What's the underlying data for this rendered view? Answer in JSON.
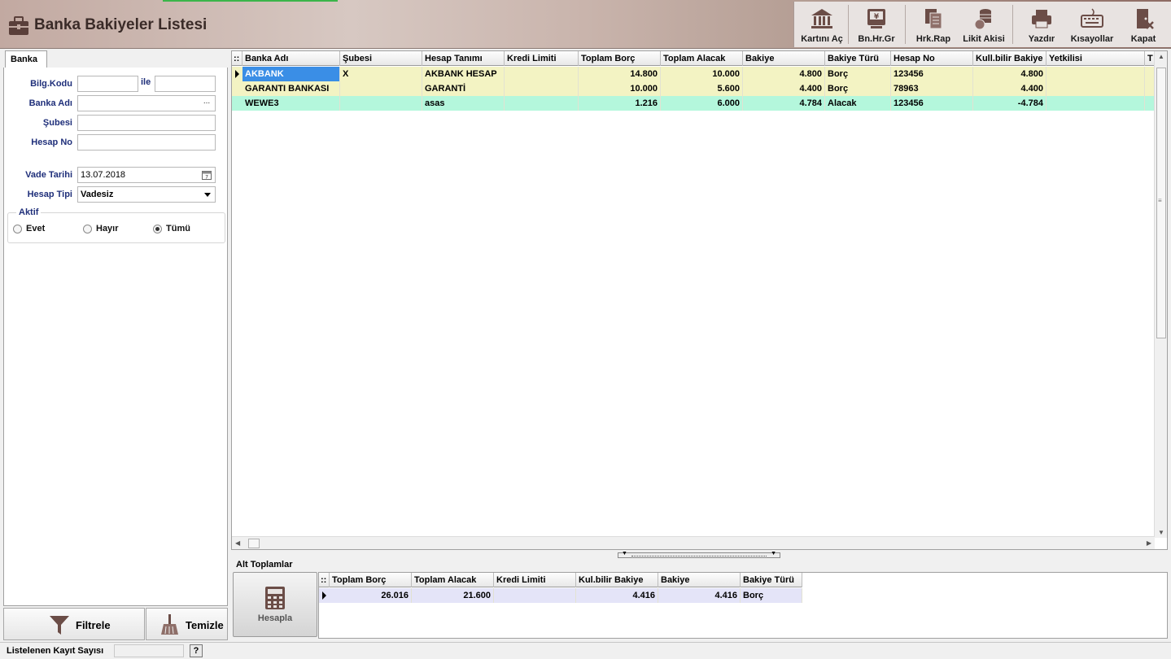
{
  "window": {
    "title": "Banka Bakiyeler Listesi"
  },
  "toolbar": [
    {
      "label": "Kartını Aç",
      "icon": "bank-icon"
    },
    {
      "label": "Bn.Hr.Gr",
      "icon": "atm-icon"
    },
    {
      "label": "Hrk.Rap",
      "icon": "report-icon"
    },
    {
      "label": "Likit Akisi",
      "icon": "coins-icon"
    },
    {
      "label": "Yazdır",
      "icon": "printer-icon"
    },
    {
      "label": "Kısayollar",
      "icon": "keyboard-icon"
    },
    {
      "label": "Kapat",
      "icon": "close-door-icon"
    }
  ],
  "filter": {
    "tab": "Banka",
    "bilg_kodu_label": "Bilg.Kodu",
    "ile_label": "ile",
    "banka_adi_label": "Banka Adı",
    "ellipsis": "...",
    "subesi_label": "Şubesi",
    "hesap_no_label": "Hesap No",
    "vade_tarihi_label": "Vade Tarihi",
    "vade_tarihi_value": "13.07.2018",
    "hesap_tipi_label": "Hesap Tipi",
    "hesap_tipi_value": "Vadesiz",
    "aktif_label": "Aktif",
    "aktif_options": [
      "Evet",
      "Hayır",
      "Tümü"
    ],
    "aktif_selected": "Tümü",
    "filtrele": "Filtrele",
    "temizle": "Temizle"
  },
  "grid": {
    "corner": "::",
    "columns": [
      "Banka Adı",
      "Şubesi",
      "Hesap Tanımı",
      "Kredi Limiti",
      "Toplam Borç",
      "Toplam Alacak",
      "Bakiye",
      "Bakiye Türü",
      "Hesap No",
      "Kull.bilir Bakiye",
      "Yetkilisi",
      "T"
    ],
    "rows": [
      {
        "banka_adi": "AKBANK",
        "subesi": "X",
        "hesap_tanimi": "AKBANK HESAP",
        "kredi_limiti": "",
        "toplam_borc": "14.800",
        "toplam_alacak": "10.000",
        "bakiye": "4.800",
        "bakiye_turu": "Borç",
        "hesap_no": "123456",
        "kull_bakiye": "4.800",
        "yetkilisi": "",
        "color": "#f3f3c3"
      },
      {
        "banka_adi": "GARANTI BANKASI",
        "subesi": "",
        "hesap_tanimi": "GARANTİ",
        "kredi_limiti": "",
        "toplam_borc": "10.000",
        "toplam_alacak": "5.600",
        "bakiye": "4.400",
        "bakiye_turu": "Borç",
        "hesap_no": "78963",
        "kull_bakiye": "4.400",
        "yetkilisi": "",
        "color": "#f3f3c3"
      },
      {
        "banka_adi": "WEWE3",
        "subesi": "",
        "hesap_tanimi": "asas",
        "kredi_limiti": "",
        "toplam_borc": "1.216",
        "toplam_alacak": "6.000",
        "bakiye": "4.784",
        "bakiye_turu": "Alacak",
        "hesap_no": "123456",
        "kull_bakiye": "-4.784",
        "yetkilisi": "",
        "color": "#b4f7dc"
      }
    ],
    "selected_color": "#3a8ee6"
  },
  "totals": {
    "title": "Alt Toplamlar",
    "hesapla": "Hesapla",
    "columns": [
      "Toplam Borç",
      "Toplam Alacak",
      "Kredi Limiti",
      "Kul.bilir Bakiye",
      "Bakiye",
      "Bakiye Türü"
    ],
    "row": {
      "toplam_borc": "26.016",
      "toplam_alacak": "21.600",
      "kredi_limiti": "",
      "kul_bakiye": "4.416",
      "bakiye": "4.416",
      "bakiye_turu": "Borç"
    },
    "row_color": "#e4e4f8"
  },
  "status": {
    "label": "Listelenen Kayıt Sayısı",
    "help": "?"
  }
}
